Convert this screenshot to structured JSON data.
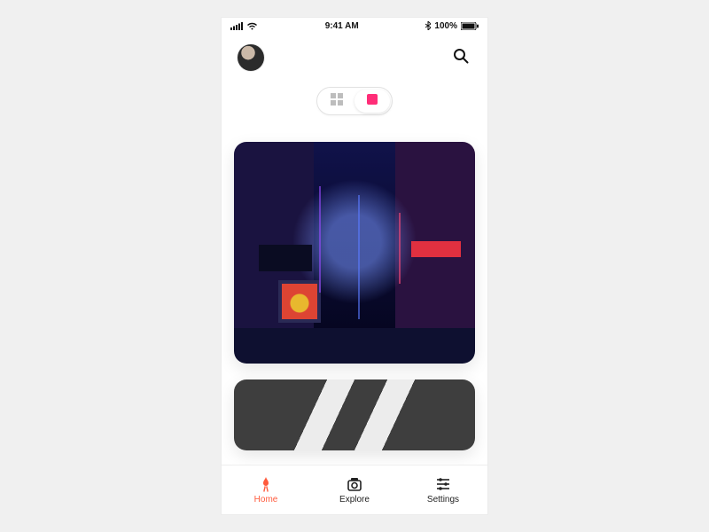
{
  "status": {
    "time": "9:41 AM",
    "battery": "100%"
  },
  "view_toggle": {
    "options": [
      "grid",
      "single"
    ],
    "selected": "single"
  },
  "accent_color": "#ff2d78",
  "tabs": {
    "home": {
      "label": "Home",
      "active": true
    },
    "explore": {
      "label": "Explore",
      "active": false
    },
    "settings": {
      "label": "Settings",
      "active": false
    }
  }
}
